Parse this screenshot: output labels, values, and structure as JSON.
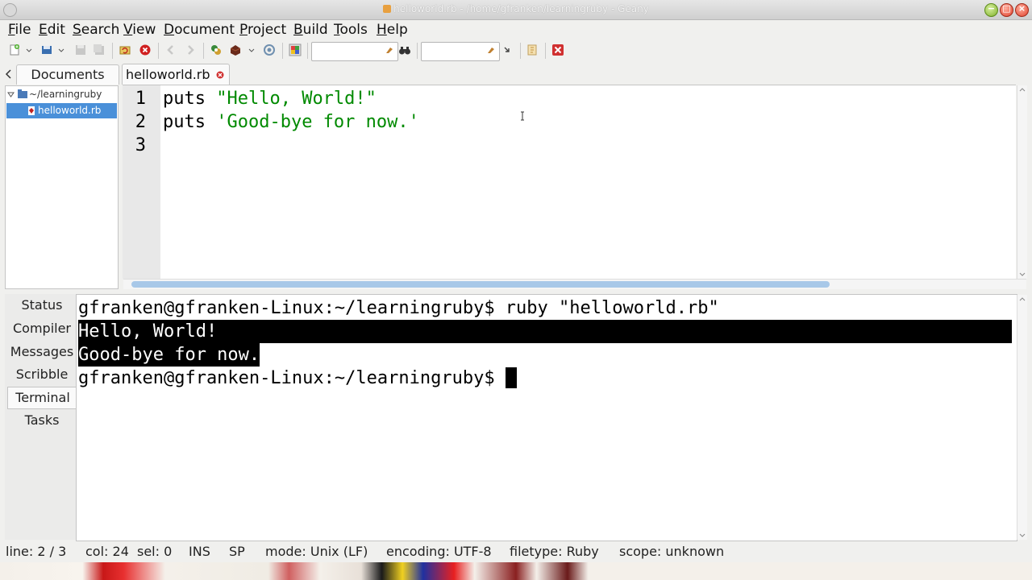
{
  "window": {
    "title": "helloworld.rb - /home/gfranken/learningruby - Geany"
  },
  "menubar": {
    "items": [
      "File",
      "Edit",
      "Search",
      "View",
      "Document",
      "Project",
      "Build",
      "Tools",
      "Help"
    ]
  },
  "toolbar": {
    "search_value": "",
    "goto_value": ""
  },
  "sidebar": {
    "tab_label": "Documents",
    "folder": "~/learningruby",
    "file": "helloworld.rb"
  },
  "editor": {
    "tab_label": "helloworld.rb",
    "lines": [
      {
        "num": "1",
        "keyword": "puts ",
        "string": "\"Hello, World!\""
      },
      {
        "num": "2",
        "keyword": "puts ",
        "string": "'Good-bye for now.'"
      },
      {
        "num": "3",
        "keyword": "",
        "string": ""
      }
    ]
  },
  "bottom_panel": {
    "tabs": [
      "Status",
      "Compiler",
      "Messages",
      "Scribble",
      "Terminal",
      "Tasks"
    ],
    "active_tab": "Terminal",
    "terminal": {
      "prompt_command": "gfranken@gfranken-Linux:~/learningruby$ ruby \"helloworld.rb\"",
      "output_1": "Hello, World!",
      "output_2": "Good-bye for now.",
      "prompt": "gfranken@gfranken-Linux:~/learningruby$ "
    }
  },
  "statusbar": {
    "line": "line: 2 / 3",
    "col": "col: 24",
    "sel": "sel: 0",
    "ins": "INS",
    "sp": "SP",
    "mode": "mode: Unix (LF)",
    "encoding": "encoding: UTF-8",
    "filetype": "filetype: Ruby",
    "scope": "scope: unknown"
  },
  "colors": {
    "string": "#008a00",
    "selected_file_bg": "#4a90d9"
  }
}
